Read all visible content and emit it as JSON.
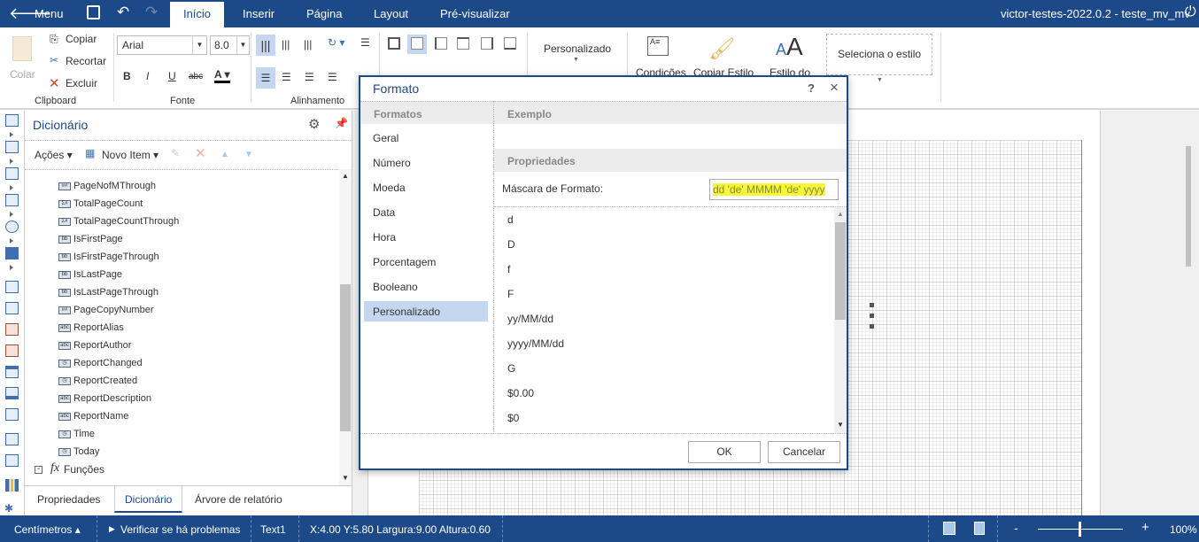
{
  "topbar": {
    "menu": "Menu",
    "tabs": [
      "Início",
      "Inserir",
      "Página",
      "Layout",
      "Pré-visualizar"
    ],
    "active_tab": "Início",
    "project": "victor-testes-2022.0.2 - teste_mv_mv",
    "brand_color": "#1c4987"
  },
  "ribbon": {
    "clipboard": {
      "label": "Clipboard",
      "paste": "Colar",
      "copy": "Copiar",
      "cut": "Recortar",
      "delete": "Excluir"
    },
    "font": {
      "label": "Fonte",
      "family": "Arial",
      "size": "8.0"
    },
    "alignment": {
      "label": "Alinhamento"
    },
    "format": {
      "value": "Personalizado"
    },
    "conditions": "Condições",
    "copy_style": "Copiar Estilo",
    "style_of": "Estilo do",
    "style_select": "Seleciona o estilo"
  },
  "dictionary": {
    "title": "Dicionário",
    "actions": "Ações",
    "new_item": "Novo Item",
    "items": [
      {
        "icon": "##",
        "label": "PageNofMThrough"
      },
      {
        "icon": "Σ#",
        "label": "TotalPageCount"
      },
      {
        "icon": "Σ#",
        "label": "TotalPageCountThrough"
      },
      {
        "icon": "bb",
        "label": "IsFirstPage"
      },
      {
        "icon": "bb",
        "label": "IsFirstPageThrough"
      },
      {
        "icon": "bb",
        "label": "IsLastPage"
      },
      {
        "icon": "bb",
        "label": "IsLastPageThrough"
      },
      {
        "icon": "##",
        "label": "PageCopyNumber"
      },
      {
        "icon": "abc",
        "label": "ReportAlias"
      },
      {
        "icon": "abc",
        "label": "ReportAuthor"
      },
      {
        "icon": "◷",
        "label": "ReportChanged"
      },
      {
        "icon": "◷",
        "label": "ReportCreated"
      },
      {
        "icon": "abc",
        "label": "ReportDescription"
      },
      {
        "icon": "abc",
        "label": "ReportName"
      },
      {
        "icon": "◷",
        "label": "Time"
      },
      {
        "icon": "◷",
        "label": "Today"
      }
    ],
    "functions": "Funções",
    "tabs": [
      "Propriedades",
      "Dicionário",
      "Árvore de relatório"
    ],
    "active_tab": "Dicionário"
  },
  "dialog": {
    "title": "Formato",
    "help": "?",
    "close": "×",
    "formats_header": "Formatos",
    "formats": [
      "Geral",
      "Número",
      "Moeda",
      "Data",
      "Hora",
      "Porcentagem",
      "Booleano",
      "Personalizado"
    ],
    "selected_format": "Personalizado",
    "example_header": "Exemplo",
    "example_value": "",
    "properties_header": "Propriedades",
    "mask_label": "Máscara de Formato:",
    "mask_value": "dd 'de' MMMM 'de' yyyy",
    "masks": [
      "d",
      "D",
      "f",
      "F",
      "yy/MM/dd",
      "yyyy/MM/dd",
      "G",
      "$0.00",
      "$0"
    ],
    "ok": "OK",
    "cancel": "Cancelar"
  },
  "status": {
    "units": "Centímetros",
    "check": "Verificar se há problemas",
    "component": "Text1",
    "position": "X:4.00 Y:5.80 Largura:9.00 Altura:0.60",
    "zoom": "100%",
    "zoom_level_percent": 100
  }
}
